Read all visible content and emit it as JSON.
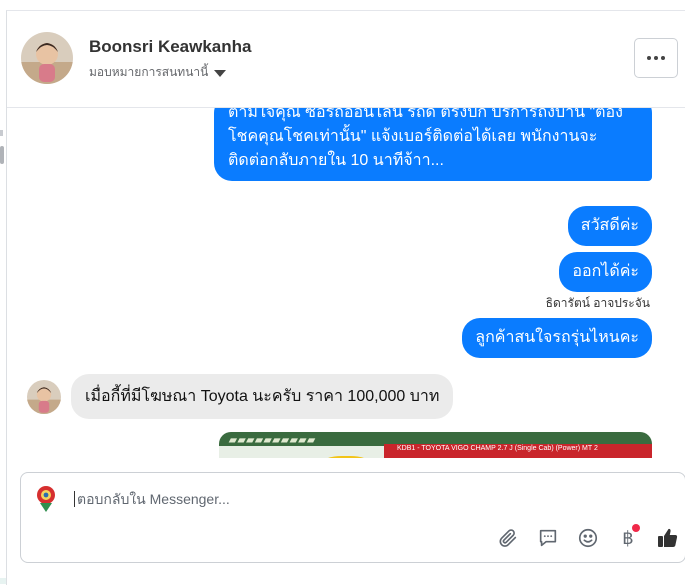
{
  "header": {
    "name": "Boonsri Keawkanha",
    "assign_label": "มอบหมายการสนทนานี้"
  },
  "messages": {
    "long_message": "ตามใจคุณ ซื้อรถออนไลน์ รถดี ตรงปก บริการถึงบ้าน \"ต้องโชคคุณโชคเท่านั้น\" แจ้งเบอร์ติดต่อได้เลย พนักงานจะติดต่อกลับภายใน 10 นาทีจ้าา...",
    "msg_1": "สวัสดีค่ะ",
    "msg_2": "ออกได้ค่ะ",
    "sender": "ธิดารัตน์ อาจประจัน",
    "msg_3": "ลูกค้าสนใจรถรุ่นไหนคะ",
    "incoming": "เมื่อกี้ที่มีโฆษณา Toyota นะครับ ราคา 100,000 บาท",
    "attachment_caption": "KDB1 - TOYOTA VIGO CHAMP 2.7 J (Single Cab) (Power) MT 2"
  },
  "composer": {
    "placeholder": "ตอบกลับใน Messenger..."
  },
  "tools": {
    "currency_glyph": "฿"
  },
  "colors": {
    "outgoing_bubble": "#0a7cff",
    "incoming_bubble": "#ebebeb",
    "notification": "#f02849"
  }
}
